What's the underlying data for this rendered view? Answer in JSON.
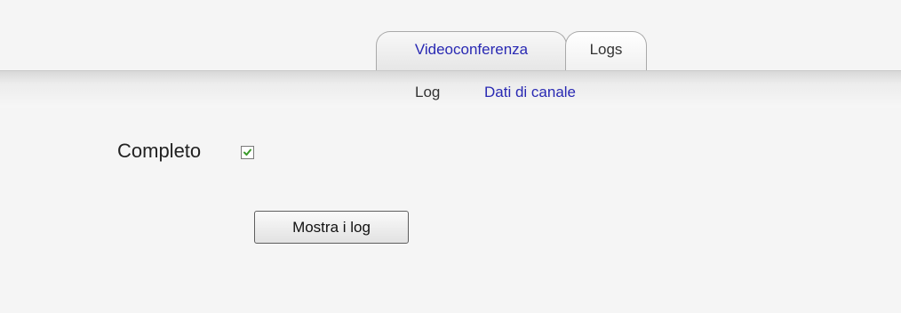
{
  "tabs": [
    {
      "label": "Videoconferenza",
      "active": false
    },
    {
      "label": "Logs",
      "active": true
    }
  ],
  "subtabs": [
    {
      "label": "Log",
      "active": true
    },
    {
      "label": "Dati di canale",
      "active": false
    }
  ],
  "form": {
    "complete_label": "Completo",
    "complete_checked": true,
    "show_button_label": "Mostra i log"
  },
  "colors": {
    "link": "#2929b3",
    "text": "#333333",
    "check": "#3a9a2a"
  }
}
